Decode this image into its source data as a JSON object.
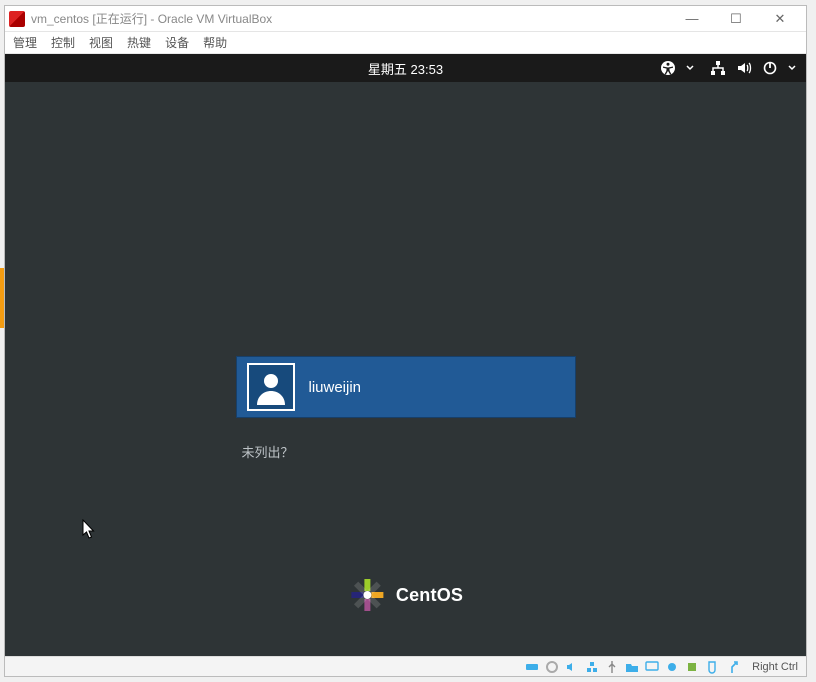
{
  "window": {
    "title": "vm_centos [正在运行] - Oracle VM VirtualBox",
    "controls": {
      "min": "—",
      "max": "☐",
      "close": "✕"
    }
  },
  "menubar": [
    "管理",
    "控制",
    "视图",
    "热键",
    "设备",
    "帮助"
  ],
  "gnome": {
    "clock": "星期五 23:53"
  },
  "login": {
    "users": [
      {
        "name": "liuweijin"
      }
    ],
    "not_listed": "未列出？"
  },
  "brand": {
    "name": "CentOS"
  },
  "statusbar": {
    "host_key": "Right Ctrl"
  }
}
